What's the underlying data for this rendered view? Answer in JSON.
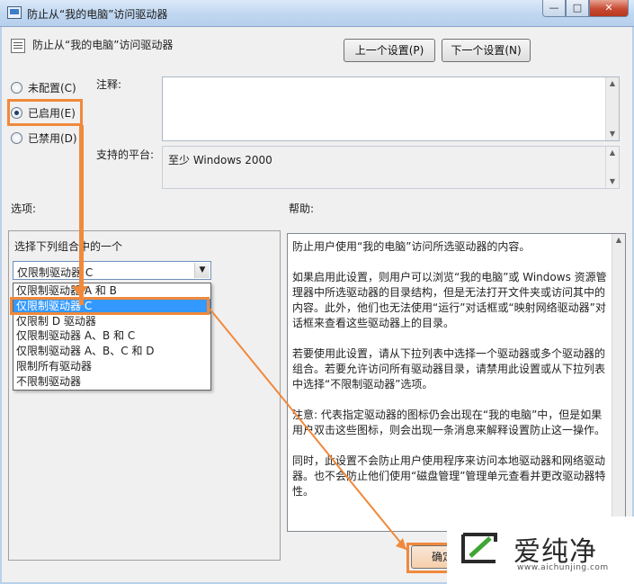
{
  "window": {
    "title": "防止从“我的电脑”访问驱动器",
    "buttons": {
      "minimize": "—",
      "maximize": "□",
      "close": "✕"
    }
  },
  "header": {
    "title": "防止从“我的电脑”访问驱动器",
    "prev_label": "上一个设置(P)",
    "next_label": "下一个设置(N)"
  },
  "state": {
    "options": [
      {
        "label": "未配置(C)",
        "checked": false
      },
      {
        "label": "已启用(E)",
        "checked": true
      },
      {
        "label": "已禁用(D)",
        "checked": false
      }
    ]
  },
  "comment": {
    "label": "注释:",
    "value": ""
  },
  "platform": {
    "label": "支持的平台:",
    "value": "至少 Windows 2000"
  },
  "options_section": {
    "label": "选项:",
    "prompt": "选择下列组合中的一个",
    "selected": "仅限制驱动器 C",
    "items": [
      "仅限制驱动器 A 和 B",
      "仅限制驱动器 C",
      "仅限制 D 驱动器",
      "仅限制驱动器 A、B 和 C",
      "仅限制驱动器 A、B、C 和 D",
      "限制所有驱动器",
      "不限制驱动器"
    ]
  },
  "help_section": {
    "label": "帮助:",
    "text": "防止用户使用“我的电脑”访问所选驱动器的内容。\n\n如果启用此设置，则用户可以浏览“我的电脑”或 Windows 资源管理器中所选驱动器的目录结构，但是无法打开文件夹或访问其中的内容。此外，他们也无法使用“运行”对话框或“映射网络驱动器”对话框来查看这些驱动器上的目录。\n\n若要使用此设置，请从下拉列表中选择一个驱动器或多个驱动器的组合。若要允许访问所有驱动器目录，请禁用此设置或从下拉列表中选择“不限制驱动器”选项。\n\n注意: 代表指定驱动器的图标仍会出现在“我的电脑”中，但是如果用户双击这些图标，则会出现一条消息来解释设置防止这一操作。\n\n同时，此设置不会防止用户使用程序来访问本地驱动器和网络驱动器。也不会防止他们使用“磁盘管理”管理单元查看并更改驱动器特性。"
  },
  "footer": {
    "ok_label": "确定"
  },
  "watermark": {
    "name": "爱纯净",
    "url": "www.aichunjing.com"
  },
  "colors": {
    "highlight": "#f0893b",
    "selection": "#3399ff"
  }
}
